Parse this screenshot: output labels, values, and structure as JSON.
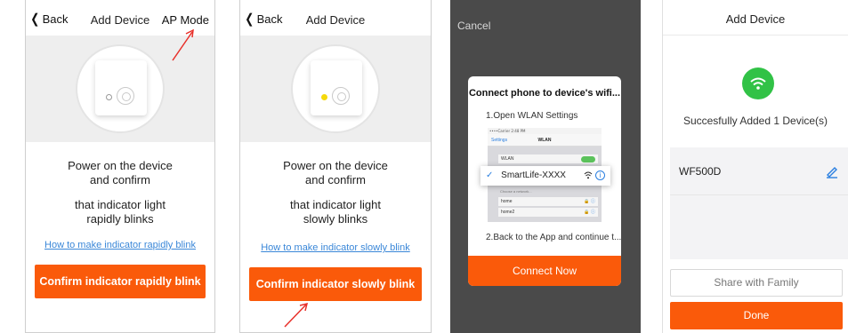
{
  "panel1": {
    "back_label": "Back",
    "title": "Add Device",
    "right_action": "AP Mode",
    "instruction_line1": "Power on the device",
    "instruction_line2": "and confirm",
    "instruction_line3": "that indicator light",
    "instruction_line4": "rapidly blinks",
    "help_link": "How to make indicator rapidly blink",
    "confirm_button": "Confirm indicator rapidly blink"
  },
  "panel2": {
    "back_label": "Back",
    "title": "Add Device",
    "instruction_line1": "Power on the device",
    "instruction_line2": "and confirm",
    "instruction_line3": "that indicator light",
    "instruction_line4": "slowly blinks",
    "help_link": "How to make indicator slowly blink",
    "confirm_button": "Confirm indicator slowly blink"
  },
  "panel3": {
    "cancel_label": "Cancel",
    "dialog_title": "Connect phone to device's wifi...",
    "step1": "1.Open WLAN Settings",
    "step2": "2.Back to the App and continue t...",
    "screenshot": {
      "status": "••••Carrier  2:48 PM",
      "nav_back": "Settings",
      "nav_title": "WLAN",
      "wlan_label": "WLAN",
      "choose_label": "Choose a network...",
      "networks": [
        "home",
        "home2"
      ]
    },
    "selected_network": "SmartLife-XXXX",
    "connect_button": "Connect Now"
  },
  "panel4": {
    "title": "Add Device",
    "success_message": "Succesfully Added 1 Device(s)",
    "device_name": "WF500D",
    "share_button": "Share with Family",
    "done_button": "Done"
  },
  "colors": {
    "accent": "#fa5a0a",
    "success": "#31c246",
    "link": "#3a87d8",
    "indicator_yellow": "#f5d90b",
    "annotation_red": "#e8302a"
  }
}
